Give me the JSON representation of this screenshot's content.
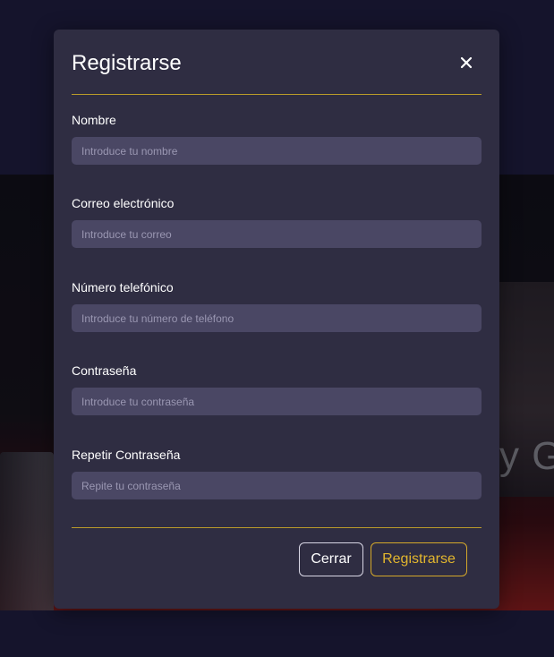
{
  "modal": {
    "title": "Registrarse",
    "close_icon": "close-icon"
  },
  "form": {
    "fields": [
      {
        "label": "Nombre",
        "placeholder": "Introduce tu nombre",
        "value": ""
      },
      {
        "label": "Correo electrónico",
        "placeholder": "Introduce tu correo",
        "value": ""
      },
      {
        "label": "Número telefónico",
        "placeholder": "Introduce tu número de teléfono",
        "value": ""
      },
      {
        "label": "Contraseña",
        "placeholder": "Introduce tu contraseña",
        "value": ""
      },
      {
        "label": "Repetir Contraseña",
        "placeholder": "Repite tu contraseña",
        "value": ""
      }
    ]
  },
  "footer": {
    "close_label": "Cerrar",
    "register_label": "Registrarse"
  },
  "background": {
    "hero_text": "y G"
  },
  "colors": {
    "accent": "#d4a82a",
    "modal_bg": "#2f2d42",
    "input_bg": "#4a4764",
    "page_bg": "#1d1b38"
  }
}
